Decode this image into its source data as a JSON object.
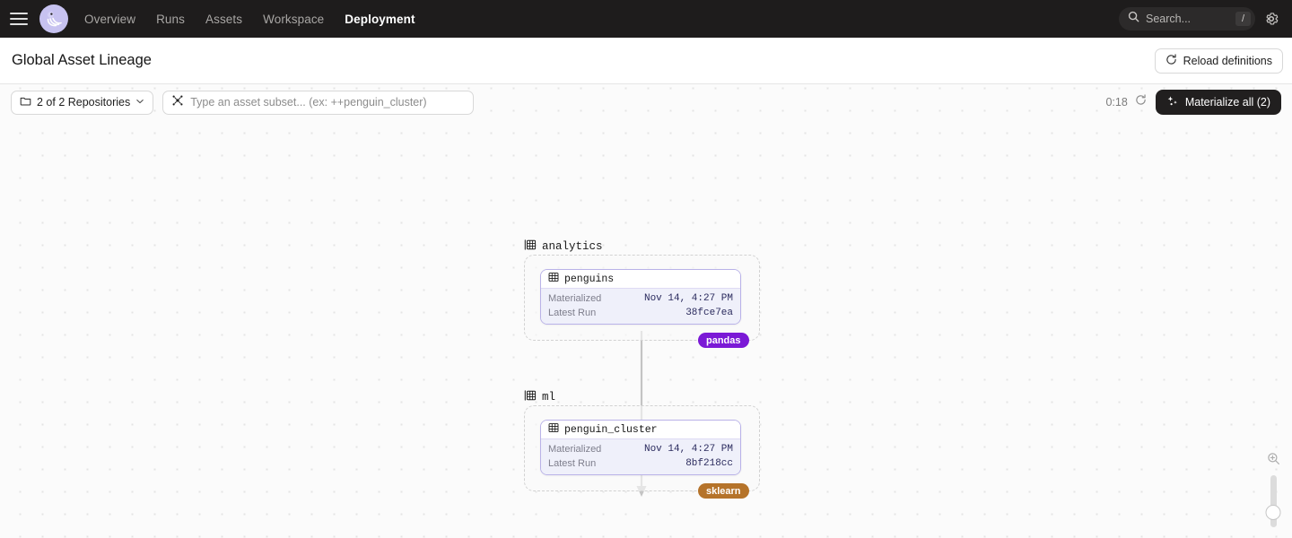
{
  "topnav": {
    "menu_icon": "hamburger-icon",
    "logo_icon": "dagster-logo",
    "links": [
      {
        "label": "Overview",
        "active": false
      },
      {
        "label": "Runs",
        "active": false
      },
      {
        "label": "Assets",
        "active": false
      },
      {
        "label": "Workspace",
        "active": false
      },
      {
        "label": "Deployment",
        "active": true
      }
    ],
    "search": {
      "placeholder": "Search...",
      "shortcut": "/",
      "icon": "search-icon"
    },
    "settings_icon": "gear-icon"
  },
  "header": {
    "title": "Global Asset Lineage",
    "reload_label": "Reload definitions",
    "reload_icon": "refresh-icon"
  },
  "filters": {
    "repositories_label": "2 of 2 Repositories",
    "repositories_icon": "folder-icon",
    "repositories_caret": "chevron-down-icon",
    "subset_placeholder": "Type an asset subset... (ex: ++penguin_cluster)",
    "subset_value": "",
    "subset_icon": "asset-graph-icon",
    "timer": "0:18",
    "timer_icon": "refresh-icon",
    "materialize_label": "Materialize all (2)",
    "materialize_icon": "sparkle-icon"
  },
  "graph": {
    "groups": [
      {
        "name": "analytics",
        "icon": "asset-group-icon",
        "tag": {
          "label": "pandas",
          "color": "#7B19D6"
        },
        "asset": {
          "name": "penguins",
          "icon": "table-icon",
          "rows": [
            {
              "key": "Materialized",
              "value": "Nov 14, 4:27 PM"
            },
            {
              "key": "Latest Run",
              "value": "38fce7ea"
            }
          ]
        }
      },
      {
        "name": "ml",
        "icon": "asset-group-icon",
        "tag": {
          "label": "sklearn",
          "color": "#B5732A"
        },
        "asset": {
          "name": "penguin_cluster",
          "icon": "table-icon",
          "rows": [
            {
              "key": "Materialized",
              "value": "Nov 14, 4:27 PM"
            },
            {
              "key": "Latest Run",
              "value": "8bf218cc"
            }
          ]
        }
      }
    ],
    "edge": {
      "from": "penguins",
      "to": "penguin_cluster"
    }
  },
  "zoom_control": {
    "zoom_in_icon": "zoom-in-icon",
    "slider_name": "zoom-slider"
  },
  "colors": {
    "nav_bg": "#1E1C1C",
    "accent_node_border": "#B9B2E8",
    "node_body_bg": "#EFF0FA",
    "canvas_bg": "#FBFBFB",
    "button_dark": "#211F1F"
  }
}
